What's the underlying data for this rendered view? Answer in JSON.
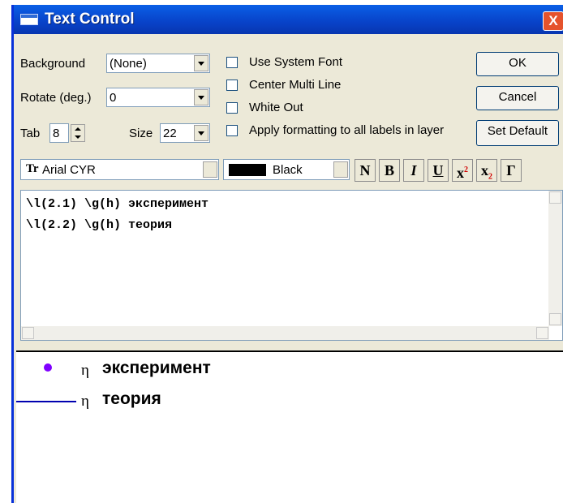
{
  "window": {
    "title": "Text Control",
    "close_label": "X"
  },
  "background": {
    "label": "Background",
    "value": "(None)"
  },
  "rotate": {
    "label": "Rotate (deg.)",
    "value": "0"
  },
  "tab": {
    "label": "Tab",
    "value": "8"
  },
  "size": {
    "label": "Size",
    "value": "22"
  },
  "checkboxes": [
    {
      "label": "Use System Font",
      "checked": false
    },
    {
      "label": "Center Multi Line",
      "checked": false
    },
    {
      "label": "White Out",
      "checked": false
    },
    {
      "label": "Apply formatting to all labels in layer",
      "checked": false
    }
  ],
  "buttons": {
    "ok": "OK",
    "cancel": "Cancel",
    "set_default": "Set Default"
  },
  "font": {
    "icon": "Tr",
    "value": "Arial CYR"
  },
  "color": {
    "value": "Black",
    "swatch": "#000000"
  },
  "format_buttons": {
    "normal": "N",
    "bold": "B",
    "italic": "I",
    "underline": "U",
    "superscript": "x",
    "subscript": "x",
    "greek": "Γ",
    "script_digit": "2"
  },
  "editor": {
    "lines": [
      "\\l(2.1) \\g(h) эксперимент",
      "\\l(2.2) \\g(h) теория"
    ]
  },
  "preview": {
    "items": [
      {
        "symbol": "η",
        "text": "эксперимент",
        "marker": "dot",
        "color": "#8000ff"
      },
      {
        "symbol": "η",
        "text": "теория",
        "marker": "line",
        "color": "#0000b0"
      }
    ]
  }
}
